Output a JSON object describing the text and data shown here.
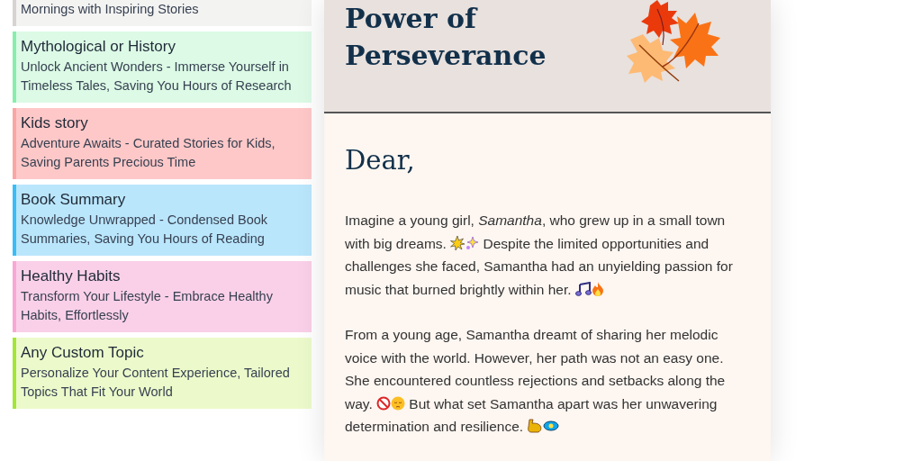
{
  "topics": [
    {
      "description": "Mornings with Inspiring Stories",
      "color": "#d6d3d1"
    },
    {
      "title": "Mythological or History",
      "description": "Unlock Ancient Wonders - Immerse Yourself in Timeless Tales, Saving You Hours of Research",
      "color": "#86efac"
    },
    {
      "title": "Kids story",
      "description": "Adventure Awaits - Curated Stories for Kids, Saving Parents Precious Time",
      "color": "#fca5a5"
    },
    {
      "title": "Book Summary",
      "description": "Knowledge Unwrapped - Condensed Book Summaries, Saving You Hours of Reading",
      "color": "#38bdf8"
    },
    {
      "title": "Healthy Habits",
      "description": "Transform Your Lifestyle - Embrace Healthy Habits, Effortlessly",
      "color": "#f9a8d4"
    },
    {
      "title": "Any Custom Topic",
      "description": "Personalize Your Content Experience, Tailored Topics That Fit Your World",
      "color": "#a3e635"
    }
  ],
  "letter": {
    "title": "Power of Perseverance",
    "greeting": "Dear,",
    "paragraphs": [
      [
        "Imagine a young girl, *Samantha*, who grew up in a small town with big dreams.",
        "Despite the limited opportunities and challenges she faced, Samantha had an unyielding passion for music that burned brightly within her."
      ],
      [
        "From a young age, Samantha dreamt of sharing her melodic voice with the world. However, her path was not an easy one. She encountered countless rejections and setbacks along the way.",
        "But what set Samantha apart was her unwavering determination and resilience."
      ]
    ]
  }
}
